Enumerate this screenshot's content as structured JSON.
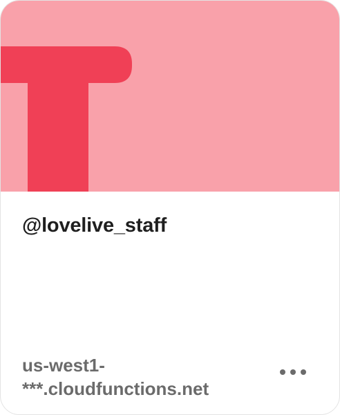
{
  "card": {
    "handle": "@lovelive_staff",
    "domain_line1": "us-west1-",
    "domain_line2": "***.cloudfunctions.net",
    "more_icon": "more-horizontal-icon"
  },
  "colors": {
    "banner": "#f9a1aa",
    "logo": "#f04056",
    "handle_text": "#1f1f1f",
    "secondary_text": "#6b6b6b"
  }
}
